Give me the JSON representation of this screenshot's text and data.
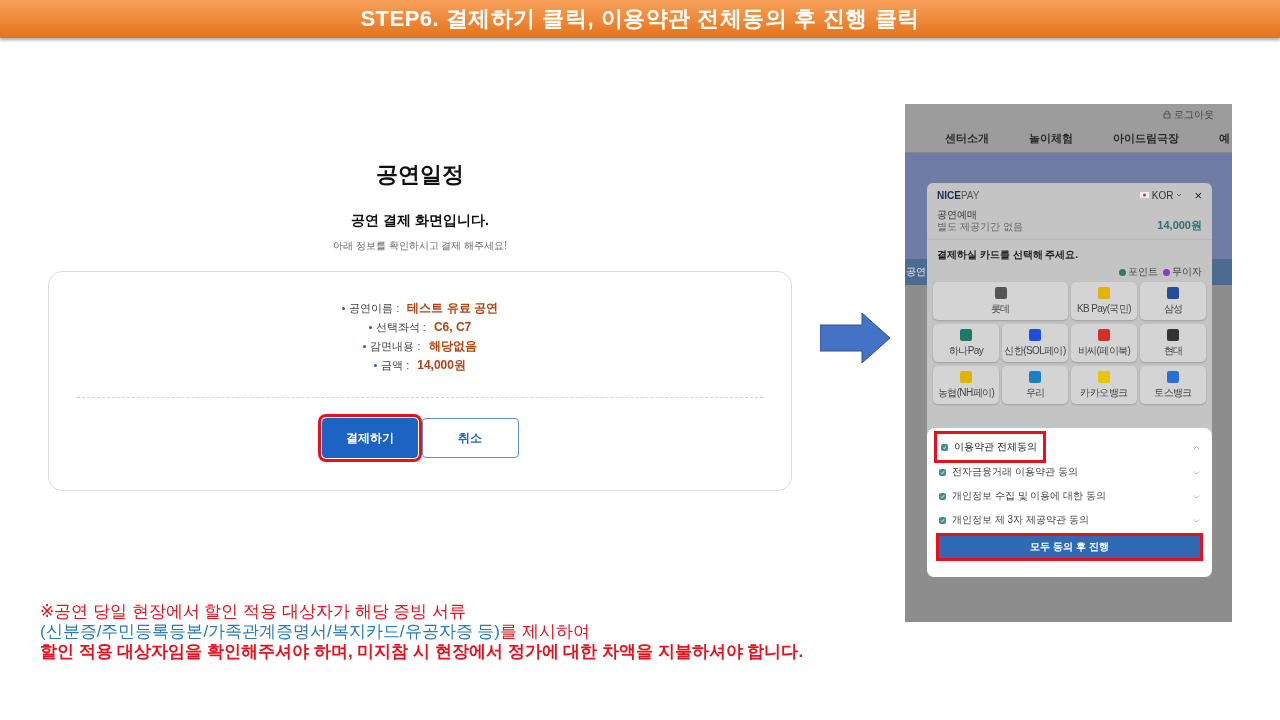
{
  "banner": {
    "title": "STEP6. 결제하기 클릭, 이용약관 전체동의 후 진행 클릭"
  },
  "payment_page": {
    "title": "공연일정",
    "subtitle": "공연 결제 화면입니다.",
    "hint": "아래 정보를 확인하시고 결제 해주세요!",
    "info": [
      {
        "label": "공연이름 :",
        "value": "테스트 유료 공연"
      },
      {
        "label": "선택좌석 :",
        "value": "C6, C7"
      },
      {
        "label": "감면내용 :",
        "value": "해당없음"
      },
      {
        "label": "금액 :",
        "value": "14,000원"
      }
    ],
    "buttons": [
      {
        "label": "결제하기",
        "kind": "primary",
        "highlighted": true
      },
      {
        "label": "취소",
        "kind": "secondary",
        "highlighted": false
      }
    ]
  },
  "site": {
    "logout": "로그아웃",
    "nav": [
      "센터소개",
      "놀이체험",
      "아이드림극장",
      "예"
    ],
    "breadcrumb": "공연"
  },
  "nicepay": {
    "logo_bold": "NICE",
    "logo_light": "PAY",
    "language": "KOR",
    "close": "×",
    "product": "공연예매",
    "period": "별도 제공기간 없음",
    "amount": "14,000원",
    "prompt": "결제하실 카드를 선택해 주세요.",
    "legend": [
      {
        "label": "포인트",
        "color": "#2f7d5e"
      },
      {
        "label": "무이자",
        "color": "#7a45c2"
      }
    ],
    "cards": [
      {
        "label": "롯데",
        "wide": true,
        "color": "#555555"
      },
      {
        "label": "KB Pay(국민)",
        "wide": false,
        "color": "#e0b400"
      },
      {
        "label": "삼성",
        "wide": false,
        "color": "#2a4a9a"
      },
      {
        "label": "하나Pay",
        "wide": false,
        "color": "#1d7a66"
      },
      {
        "label": "신한(SOL페이)",
        "wide": false,
        "color": "#1f4fd6"
      },
      {
        "label": "비씨(페이북)",
        "wide": false,
        "color": "#d0302a"
      },
      {
        "label": "현대",
        "wide": false,
        "color": "#333333"
      },
      {
        "label": "농협(NH페이)",
        "wide": false,
        "color": "#e0b400"
      },
      {
        "label": "우리",
        "wide": false,
        "color": "#1a7fc4"
      },
      {
        "label": "카카오뱅크",
        "wide": false,
        "color": "#e8c600"
      },
      {
        "label": "토스뱅크",
        "wide": false,
        "color": "#2a6fdb"
      }
    ],
    "terms": {
      "all": {
        "label": "이용약관 전체동의",
        "checked": true,
        "expanded": true,
        "highlighted": true
      },
      "items": [
        {
          "label": "전자금융거래 이용약관 동의",
          "checked": true,
          "expanded": false
        },
        {
          "label": "개인정보 수집 및 이용에 대한 동의",
          "checked": true,
          "expanded": false
        },
        {
          "label": "개인정보 제 3자 제공약관 동의",
          "checked": true,
          "expanded": false
        }
      ],
      "button": {
        "label": "모두 동의 후 진행",
        "highlighted": true
      }
    }
  },
  "notes": [
    {
      "kind": "plain",
      "parts": [
        {
          "text": "※공연 당일 현장에서 할인 적용 대상자가 해당 증빙 서류",
          "color": "#e8101c"
        }
      ]
    },
    {
      "kind": "plain",
      "parts": [
        {
          "text": "(신분증/주민등록등본/가족관계증명서/복지카드/유공자증 등)",
          "color": "#2a7ab8"
        },
        {
          "text": "를 제시하여",
          "color": "#e8101c"
        }
      ]
    },
    {
      "kind": "bold",
      "parts": [
        {
          "text": "할인 적용 대상자임을 확인해주셔야 하며, 미지참 시 현장에서 정가에 대한 차액을 지불하셔야 합니다.",
          "color": "#e8101c"
        }
      ]
    }
  ]
}
